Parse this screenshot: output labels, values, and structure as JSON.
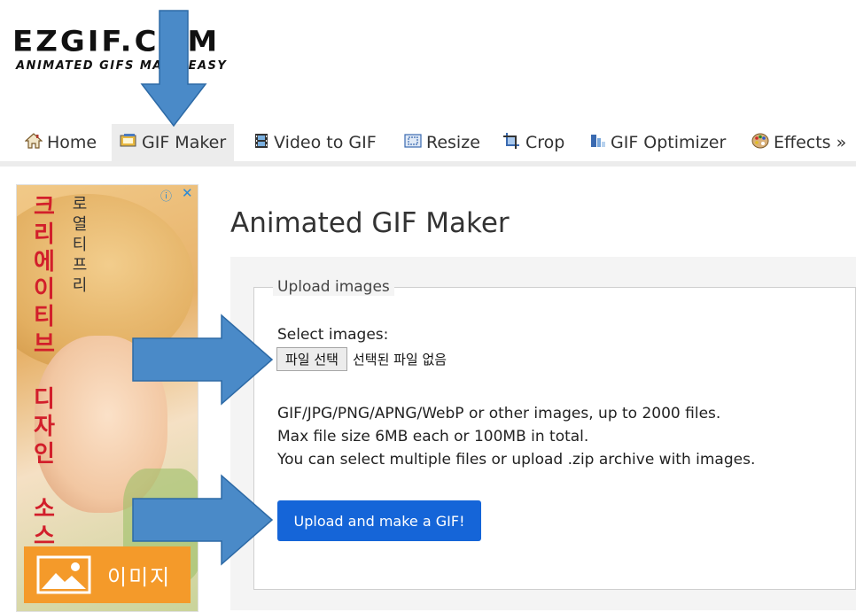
{
  "logo": {
    "name": "EZGIF.COM",
    "tagline": "ANIMATED GIFS MADE EASY"
  },
  "nav": {
    "items": [
      {
        "label": "Home",
        "icon": "home-icon"
      },
      {
        "label": "GIF Maker",
        "icon": "gif-maker-icon",
        "active": true
      },
      {
        "label": "Video to GIF",
        "icon": "film-icon"
      },
      {
        "label": "Resize",
        "icon": "resize-icon"
      },
      {
        "label": "Crop",
        "icon": "crop-icon"
      },
      {
        "label": "GIF Optimizer",
        "icon": "optimizer-icon"
      },
      {
        "label": "Effects »",
        "icon": "palette-icon"
      }
    ]
  },
  "ad": {
    "headline": "크\n리\n에\n이\n티\n브\n\n디\n자\n인\n\n소\n스",
    "subline": "로\n열\n티\n프\n리",
    "cta": "이미지",
    "info_glyph": "ⓘ",
    "close_glyph": "✕"
  },
  "main": {
    "title": "Animated GIF Maker",
    "legend": "Upload images",
    "select_label": "Select images:",
    "file_button": "파일 선택",
    "file_status": "선택된 파일 없음",
    "info_lines": [
      "GIF/JPG/PNG/APNG/WebP or other images, up to 2000 files.",
      "Max file size 6MB each or 100MB in total.",
      "You can select multiple files or upload .zip archive with images."
    ],
    "upload_button": "Upload and make a GIF!"
  },
  "colors": {
    "accent": "#1565d8",
    "arrow": "#4a8ac8",
    "arrow_border": "#2d6aa6",
    "ad_red": "#d21f2b",
    "ad_orange": "#f49a2a"
  }
}
